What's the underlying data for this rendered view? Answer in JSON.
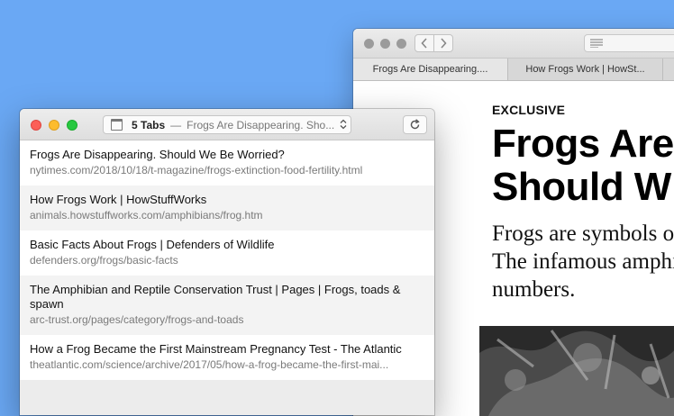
{
  "background_window": {
    "tabs": [
      {
        "label": "Frogs Are Disappearing...."
      },
      {
        "label": "How Frogs Work | HowSt..."
      }
    ],
    "article": {
      "kicker": "EXCLUSIVE",
      "headline_line1": "Frogs Are",
      "headline_line2": "Should W",
      "summary_line1": "Frogs are symbols of",
      "summary_line2": "The infamous amphi",
      "summary_line3": "numbers."
    }
  },
  "tab_overview": {
    "tab_count": "5 Tabs",
    "separator": "—",
    "current_tab": "Frogs Are Disappearing. Sho...",
    "tabs": [
      {
        "title": "Frogs Are Disappearing. Should We Be Worried?",
        "url": "nytimes.com/2018/10/18/t-magazine/frogs-extinction-food-fertility.html"
      },
      {
        "title": "How Frogs Work | HowStuffWorks",
        "url": "animals.howstuffworks.com/amphibians/frog.htm"
      },
      {
        "title": "Basic Facts About Frogs | Defenders of Wildlife",
        "url": "defenders.org/frogs/basic-facts"
      },
      {
        "title": "The Amphibian and Reptile Conservation Trust | Pages | Frogs, toads & spawn",
        "url": "arc-trust.org/pages/category/frogs-and-toads"
      },
      {
        "title": "How a Frog Became the First Mainstream Pregnancy Test - The Atlantic",
        "url": "theatlantic.com/science/archive/2017/05/how-a-frog-became-the-first-mai..."
      }
    ]
  },
  "colors": {
    "desktop": "#6aa8f4",
    "close": "#fc5f57",
    "minimize": "#fdbc2e",
    "maximize": "#27c840"
  }
}
